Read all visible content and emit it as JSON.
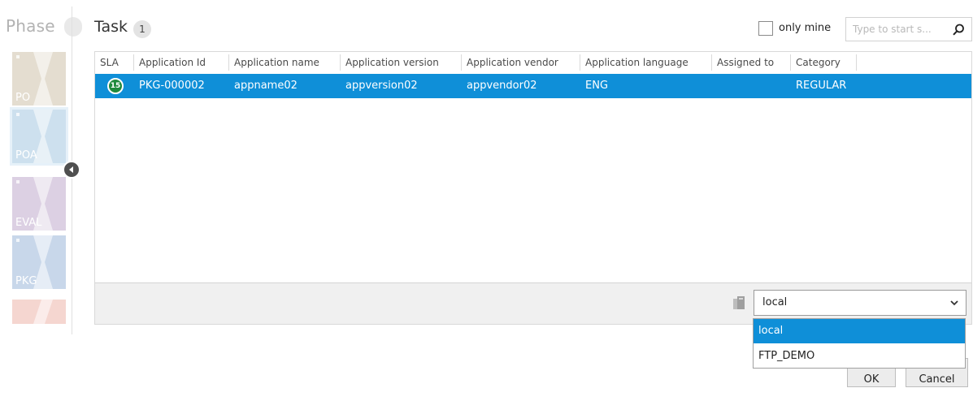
{
  "phase_panel": {
    "title": "Phase",
    "tiles": [
      {
        "label": "PO",
        "color": "#e4ddd0"
      },
      {
        "label": "POA",
        "color": "#cde0ee"
      },
      {
        "label": "EVAL",
        "color": "#dcd0e3"
      },
      {
        "label": "PKG",
        "color": "#c8d7ea"
      },
      {
        "label": "",
        "color": "#f5d6d0"
      }
    ]
  },
  "task": {
    "title": "Task",
    "count": "1"
  },
  "filters": {
    "only_mine_label": "only mine",
    "only_mine_checked": false,
    "search_placeholder": "Type to start s...",
    "search_value": ""
  },
  "grid": {
    "columns": [
      "SLA",
      "Application Id",
      "Application name",
      "Application version",
      "Application vendor",
      "Application language",
      "Assigned to",
      "Category"
    ],
    "rows": [
      {
        "sla": "15",
        "application_id": "PKG-000002",
        "application_name": "appname02",
        "application_version": "appversion02",
        "application_vendor": "appvendor02",
        "application_language": "ENG",
        "assigned_to": "",
        "category": "REGULAR",
        "selected": true
      }
    ]
  },
  "storage": {
    "selected": "local",
    "options": [
      "local",
      "FTP_DEMO"
    ]
  },
  "buttons": {
    "ok": "OK",
    "cancel": "Cancel"
  },
  "colors": {
    "selection": "#0f8fd8",
    "sla_badge": "#208a3c"
  }
}
